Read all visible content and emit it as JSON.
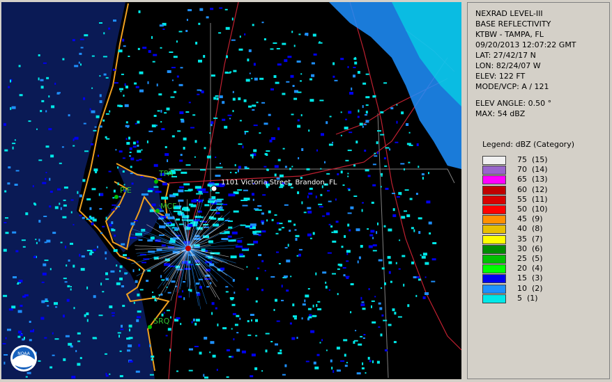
{
  "radar": {
    "map_labels": {
      "address": "1101 Victoria Street, Brandon, FL",
      "station_tpa": "TPA",
      "station_pie": "PIE",
      "station_mcf": "MCF",
      "station_srq": "SRQ",
      "logo": "NOAA"
    },
    "colors": {
      "ocean": "#0a1a55",
      "land": "#000000",
      "coast_outline": "#f0a020",
      "roads": "#c02030",
      "county_lines": "#808080",
      "station_label": "#30c030"
    }
  },
  "info": {
    "product": "NEXRAD LEVEL-III",
    "type": "BASE REFLECTIVITY",
    "station": "KTBW - TAMPA, FL",
    "datetime": "09/20/2013 12:07:22 GMT",
    "lat": "LAT: 27/42/17 N",
    "lon": "LON: 82/24/07 W",
    "elev": "ELEV: 122 FT",
    "mode": "MODE/VCP: A / 121",
    "elev_angle": "ELEV ANGLE: 0.50 °",
    "max": "MAX: 54 dBZ"
  },
  "legend": {
    "title": "Legend: dBZ (Category)",
    "items": [
      {
        "label": "75  (15)",
        "color": "#f0f0f0"
      },
      {
        "label": "70  (14)",
        "color": "#9966cc"
      },
      {
        "label": "65  (13)",
        "color": "#ff00ff"
      },
      {
        "label": "60  (12)",
        "color": "#c00000"
      },
      {
        "label": "55  (11)",
        "color": "#d80000"
      },
      {
        "label": "50  (10)",
        "color": "#ff0000"
      },
      {
        "label": "45  (9)",
        "color": "#ff9000"
      },
      {
        "label": "40  (8)",
        "color": "#e8c000"
      },
      {
        "label": "35  (7)",
        "color": "#ffff00"
      },
      {
        "label": "30  (6)",
        "color": "#008c00"
      },
      {
        "label": "25  (5)",
        "color": "#00c000"
      },
      {
        "label": "20  (4)",
        "color": "#00ff00"
      },
      {
        "label": "15  (3)",
        "color": "#0000f0"
      },
      {
        "label": "10  (2)",
        "color": "#1e90ff"
      },
      {
        "label": "5  (1)",
        "color": "#00e8e8"
      }
    ]
  }
}
